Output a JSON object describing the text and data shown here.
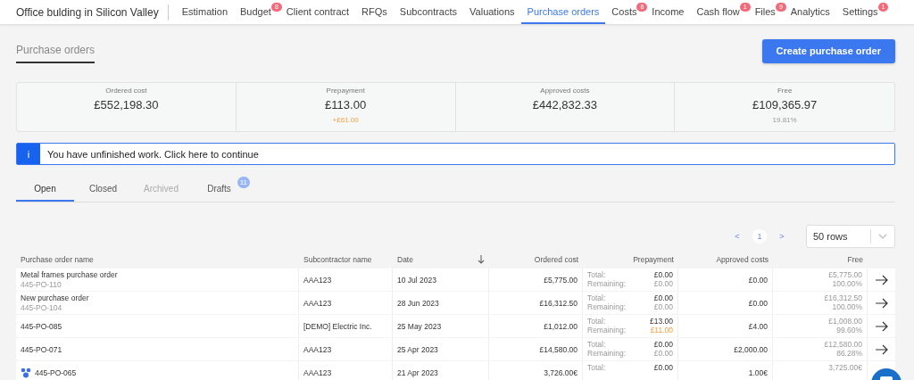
{
  "project": {
    "title": "Office bulding in Silicon Valley"
  },
  "nav": [
    {
      "label": "Estimation",
      "selected": false
    },
    {
      "label": "Budget",
      "badge": "8",
      "selected": false
    },
    {
      "label": "Client contract",
      "selected": false
    },
    {
      "label": "RFQs",
      "selected": false
    },
    {
      "label": "Subcontracts",
      "selected": false
    },
    {
      "label": "Valuations",
      "selected": false
    },
    {
      "label": "Purchase orders",
      "selected": true
    },
    {
      "label": "Costs",
      "badge": "8",
      "selected": false
    },
    {
      "label": "Income",
      "selected": false
    },
    {
      "label": "Cash flow",
      "badge": "1",
      "selected": false
    },
    {
      "label": "Files",
      "badge": "9",
      "selected": false
    },
    {
      "label": "Analytics",
      "selected": false
    },
    {
      "label": "Settings",
      "badge": "1",
      "selected": false
    }
  ],
  "page_title": "Purchase orders",
  "create_button": "Create purchase order",
  "summary": [
    {
      "label": "Ordered cost",
      "value": "£552,198.30"
    },
    {
      "label": "Prepayment",
      "value": "£113.00",
      "note": "+£61.00",
      "note_highlighted": true
    },
    {
      "label": "Approved costs",
      "value": "£442,832.33"
    },
    {
      "label": "Free",
      "value": "£109,365.97",
      "note": "19.81%",
      "note_highlighted": false
    }
  ],
  "notice": {
    "icon_text": "i",
    "message": "You have unfinished work. Click here to continue"
  },
  "tabs": [
    {
      "label": "Open",
      "selected": true,
      "disabled": false
    },
    {
      "label": "Closed",
      "selected": false,
      "disabled": false
    },
    {
      "label": "Archived",
      "selected": false,
      "disabled": true
    },
    {
      "label": "Drafts",
      "selected": false,
      "disabled": false,
      "badge": "11"
    }
  ],
  "pagination": {
    "prev": "<",
    "page": "1",
    "next": ">",
    "rows_select": "50 rows"
  },
  "table": {
    "columns": [
      {
        "label": "Purchase order name"
      },
      {
        "label": "Subcontractor name"
      },
      {
        "label": "Date",
        "sorted": true
      },
      {
        "label": "Ordered cost"
      },
      {
        "label": "Prepayment"
      },
      {
        "label": "Approved costs"
      },
      {
        "label": "Free"
      }
    ],
    "rows": [
      {
        "name": "Metal frames purchase order",
        "code": "445-PO-110",
        "subcontractor": "AAA123",
        "date": "10 Jul 2023",
        "ordered_cost": "£5,775.00",
        "total_label": "Total:",
        "prepay_total": "£0.00",
        "remaining_label": "Remaining:",
        "prepay_remaining": "£0.00",
        "remaining_warning": false,
        "approved": "£0.00",
        "free": "£5,775.00",
        "free_pct": "100.00%"
      },
      {
        "name": "New purchase order",
        "code": "445-PO-104",
        "subcontractor": "AAA123",
        "date": "28 Jun 2023",
        "ordered_cost": "£16,312.50",
        "total_label": "Total:",
        "prepay_total": "£0.00",
        "remaining_label": "Remaining:",
        "prepay_remaining": "£0.00",
        "remaining_warning": false,
        "approved": "£0.00",
        "free": "£16,312.50",
        "free_pct": "100.00%"
      },
      {
        "name": "445-PO-085",
        "subcontractor": "[DEMO] Electric Inc.",
        "date": "25 May 2023",
        "ordered_cost": "£1,012.00",
        "total_label": "Total:",
        "prepay_total": "£13.00",
        "remaining_label": "Remaining:",
        "prepay_remaining": "£11.00",
        "remaining_warning": true,
        "approved": "£4.00",
        "free": "£1,008.00",
        "free_pct": "99.60%"
      },
      {
        "name": "445-PO-071",
        "subcontractor": "AAA123",
        "date": "25 Apr 2023",
        "ordered_cost": "£14,580.00",
        "total_label": "Total:",
        "prepay_total": "£0.00",
        "remaining_label": "Remaining:",
        "prepay_remaining": "£0.00",
        "remaining_warning": false,
        "approved": "£2,000.00",
        "free": "£12,580.00",
        "free_pct": "86.28%"
      },
      {
        "name": "445-PO-065",
        "grouped": true,
        "subcontractor": "AAA123",
        "date": "21 Apr 2023",
        "ordered_cost": "3,726.00€",
        "total_label": "Total:",
        "prepay_total": "£0.00",
        "approved": "1.00€",
        "free": "3,725.00€"
      }
    ]
  }
}
